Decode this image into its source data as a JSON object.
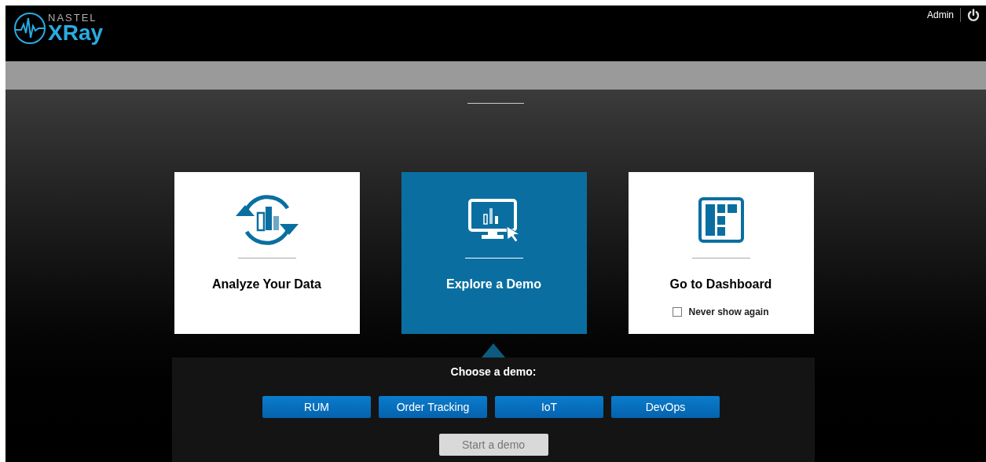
{
  "header": {
    "logo_top": "NASTEL",
    "logo_main": "XRay",
    "user": "Admin"
  },
  "cards": [
    {
      "kind": "analyze",
      "label": "Analyze Your Data",
      "selected": false
    },
    {
      "kind": "demo",
      "label": "Explore a Demo",
      "selected": true
    },
    {
      "kind": "dashboard",
      "label": "Go to Dashboard",
      "selected": false,
      "checkbox": {
        "label": "Never show again",
        "checked": false
      }
    }
  ],
  "demo_panel": {
    "title": "Choose a demo:",
    "demos": [
      {
        "label": "RUM",
        "selected": false
      },
      {
        "label": "Order Tracking",
        "selected": false
      },
      {
        "label": "IoT",
        "selected": false
      },
      {
        "label": "DevOps",
        "selected": false
      }
    ],
    "start_button": {
      "label": "Start a demo",
      "disabled": true
    }
  }
}
